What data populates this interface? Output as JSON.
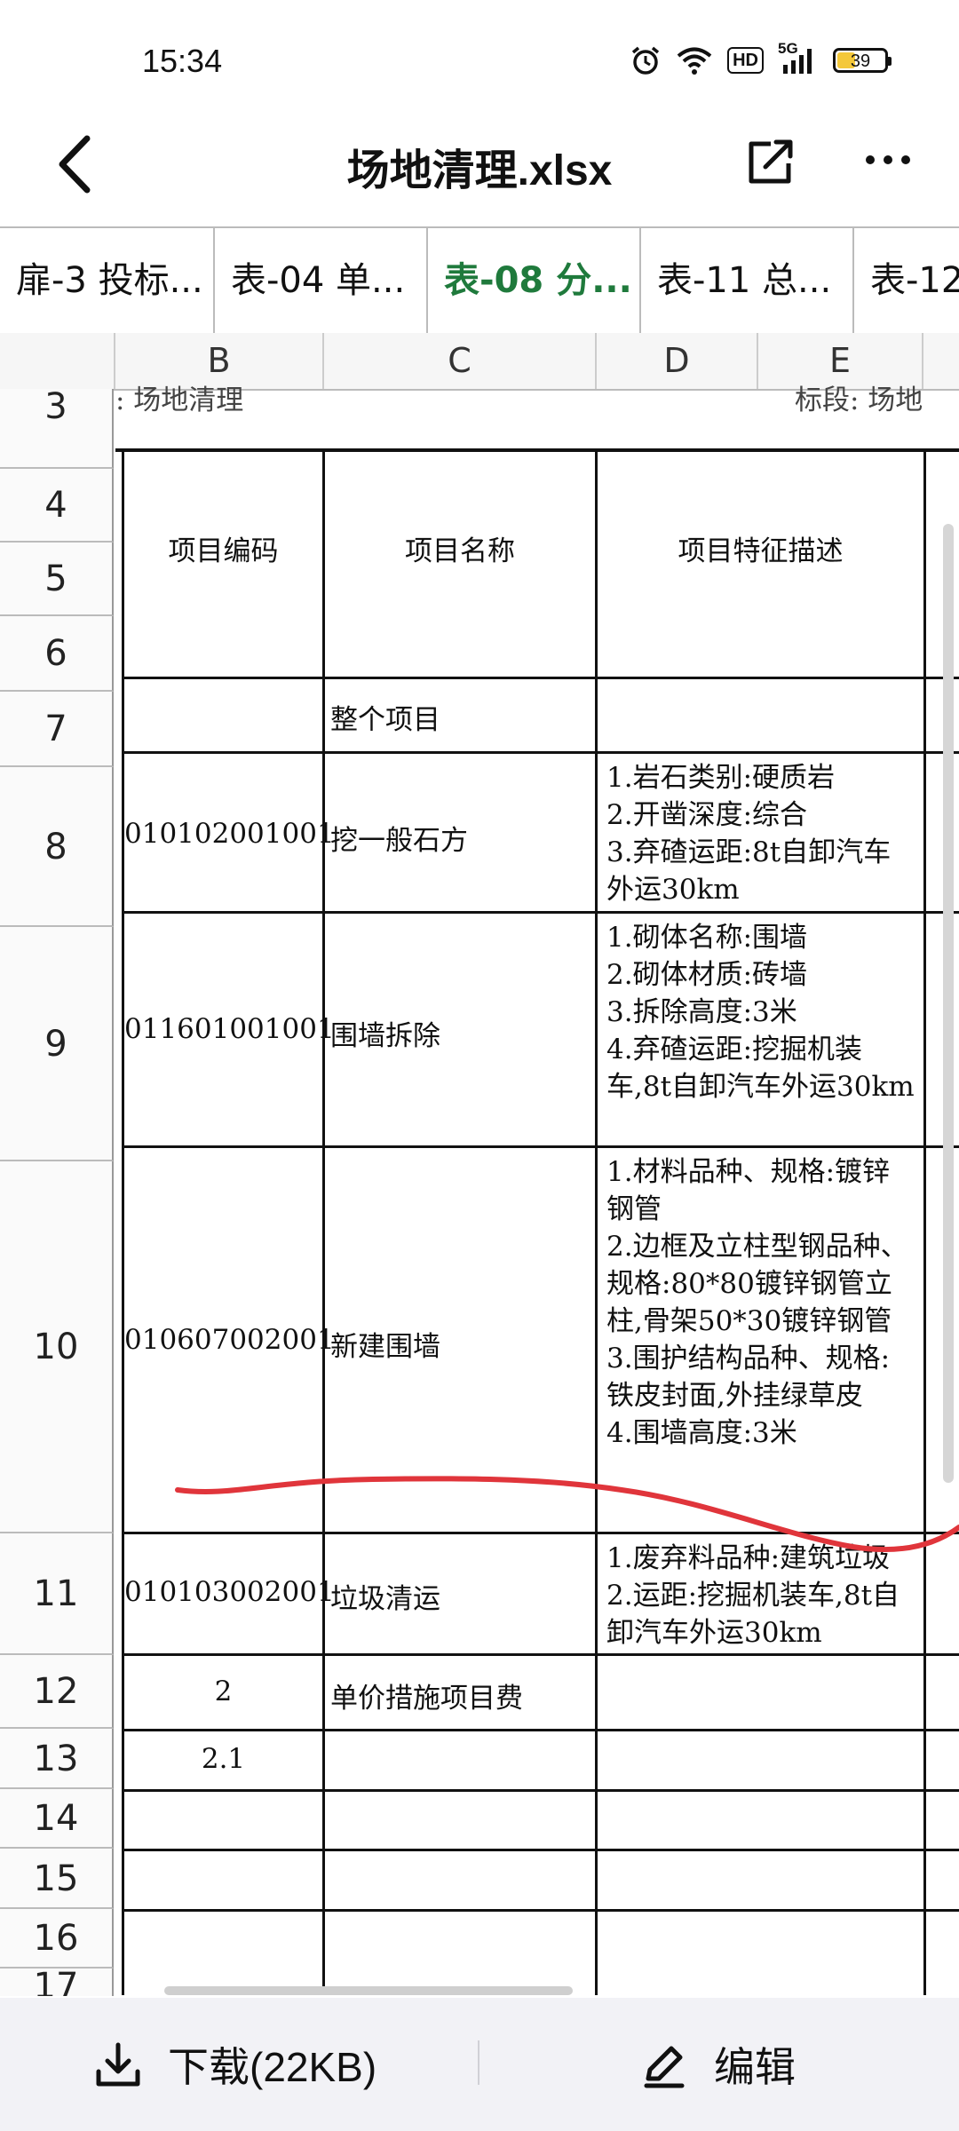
{
  "status": {
    "time": "15:34",
    "battery": "39",
    "battery_level": 0.39,
    "hd_label": "HD",
    "net_label": "5G"
  },
  "header": {
    "title": "场地清理.xlsx"
  },
  "tabs": [
    "扉-3 投标...",
    "表-04 单...",
    "表-08 分...",
    "表-11 总...",
    "表-12"
  ],
  "active_tab_index": 2,
  "columns": [
    "B",
    "C",
    "D",
    "E"
  ],
  "rows_numbers": [
    "3",
    "4",
    "5",
    "6",
    "7",
    "8",
    "9",
    "10",
    "11",
    "12",
    "13",
    "14",
    "15",
    "16",
    "17"
  ],
  "sheet": {
    "row3_left": ":  场地清理",
    "row3_right": "标段:  场地",
    "header": {
      "code": "项目编码",
      "name": "项目名称",
      "desc": "项目特征描述"
    },
    "r7": {
      "name": "整个项目"
    },
    "r8": {
      "code": "010102001001",
      "name": "挖一般石方",
      "desc": "1.岩石类别:硬质岩\n2.开凿深度:综合\n3.弃碴运距:8t自卸汽车外运30km"
    },
    "r9": {
      "code": "011601001001",
      "name": "围墙拆除",
      "desc": "1.砌体名称:围墙\n2.砌体材质:砖墙\n3.拆除高度:3米\n4.弃碴运距:挖掘机装车,8t自卸汽车外运30km"
    },
    "r10": {
      "code": "010607002001",
      "name": "新建围墙",
      "desc": "1.材料品种、规格:镀锌钢管\n2.边框及立柱型钢品种、规格:80*80镀锌钢管立柱,骨架50*30镀锌钢管\n3.围护结构品种、规格:铁皮封面,外挂绿草皮\n4.围墙高度:3米"
    },
    "r11": {
      "code": "010103002001",
      "name": "垃圾清运",
      "desc": "1.废弃料品种:建筑垃圾\n2.运距:挖掘机装车,8t自卸汽车外运30km"
    },
    "r12": {
      "code": "2",
      "name": "单价措施项目费"
    },
    "r13": {
      "code": "2.1"
    }
  },
  "bottom": {
    "download": "下载(22KB)",
    "edit": "编辑"
  },
  "colors": {
    "accent_tab": "#1f7a3c",
    "scribble": "#e0353b",
    "bottom_bg": "#f2f2f6"
  }
}
